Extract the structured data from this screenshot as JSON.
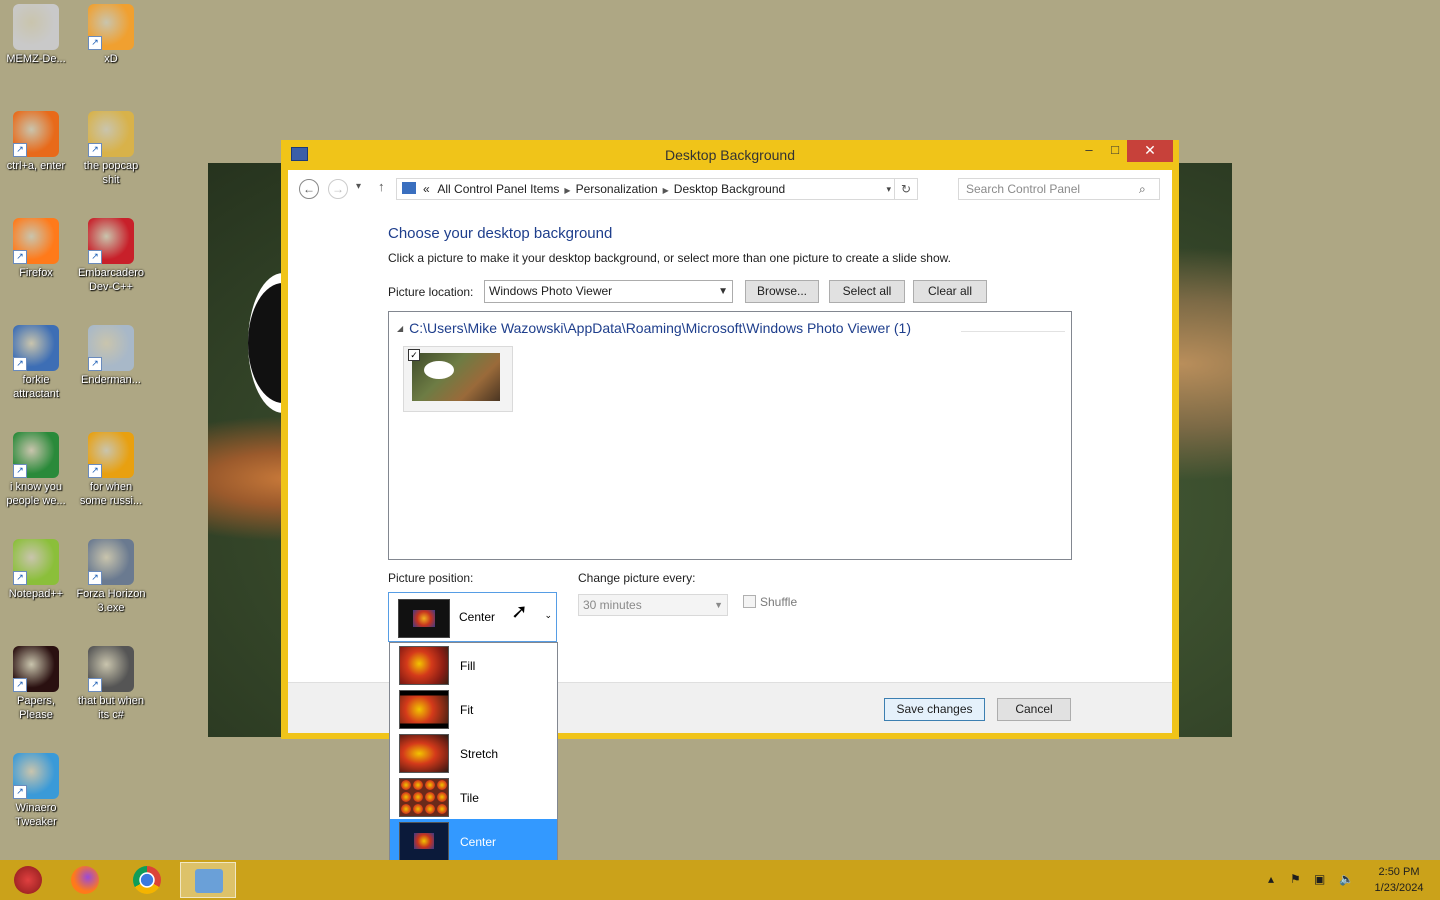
{
  "desktop": {
    "icons": [
      {
        "label": "MEMZ-De...",
        "color": "#c9c9c9"
      },
      {
        "label": "xD",
        "color": "#f0a030"
      },
      {
        "label": "ctrl+a, enter",
        "color": "#e86a1a"
      },
      {
        "label": "the popcap shit",
        "color": "#d8b24a"
      },
      {
        "label": "Firefox",
        "color": "#ff7a1a"
      },
      {
        "label": "Embarcadero Dev-C++",
        "color": "#c8202a"
      },
      {
        "label": "forkie attractant",
        "color": "#3d6eb5"
      },
      {
        "label": "Enderman...",
        "color": "#a8b8c8"
      },
      {
        "label": "i know you people we...",
        "color": "#2a8a3a"
      },
      {
        "label": "for when some russi...",
        "color": "#e8a010"
      },
      {
        "label": "Notepad++",
        "color": "#8bbf3a"
      },
      {
        "label": "Forza Horizon 3.exe",
        "color": "#6a7a90"
      },
      {
        "label": "Papers, Please",
        "color": "#2a1010"
      },
      {
        "label": "that but when its c#",
        "color": "#555555"
      },
      {
        "label": "Winaero Tweaker",
        "color": "#3a9ad8"
      }
    ]
  },
  "window": {
    "title": "Desktop Background",
    "controls": {
      "minimize": "–",
      "maximize": "□",
      "close": "✕"
    }
  },
  "nav": {
    "breadcrumb_prefix": "«",
    "breadcrumbs": [
      "All Control Panel Items",
      "Personalization",
      "Desktop Background"
    ],
    "search_placeholder": "Search Control Panel"
  },
  "content": {
    "heading": "Choose your desktop background",
    "subtext": "Click a picture to make it your desktop background, or select more than one picture to create a slide show.",
    "location_label": "Picture location:",
    "location_value": "Windows Photo Viewer",
    "browse_label": "Browse...",
    "select_all_label": "Select all",
    "clear_all_label": "Clear all",
    "folder_path": "C:\\Users\\Mike Wazowski\\AppData\\Roaming\\Microsoft\\Windows Photo Viewer (1)",
    "thumbnail_checked": true
  },
  "position": {
    "label": "Picture position:",
    "selected": "Center",
    "options": [
      "Fill",
      "Fit",
      "Stretch",
      "Tile",
      "Center"
    ]
  },
  "slideshow": {
    "label": "Change picture every:",
    "interval": "30 minutes",
    "shuffle_label": "Shuffle"
  },
  "footer": {
    "save_label": "Save changes",
    "cancel_label": "Cancel"
  },
  "taskbar": {
    "time": "2:50 PM",
    "date": "1/23/2024"
  },
  "colors": {
    "window_frame": "#f0c419",
    "close_button": "#c7413a",
    "heading": "#1e3e8c",
    "selection": "#3399ff",
    "taskbar": "#cba21a",
    "desktop": "#aea784"
  }
}
